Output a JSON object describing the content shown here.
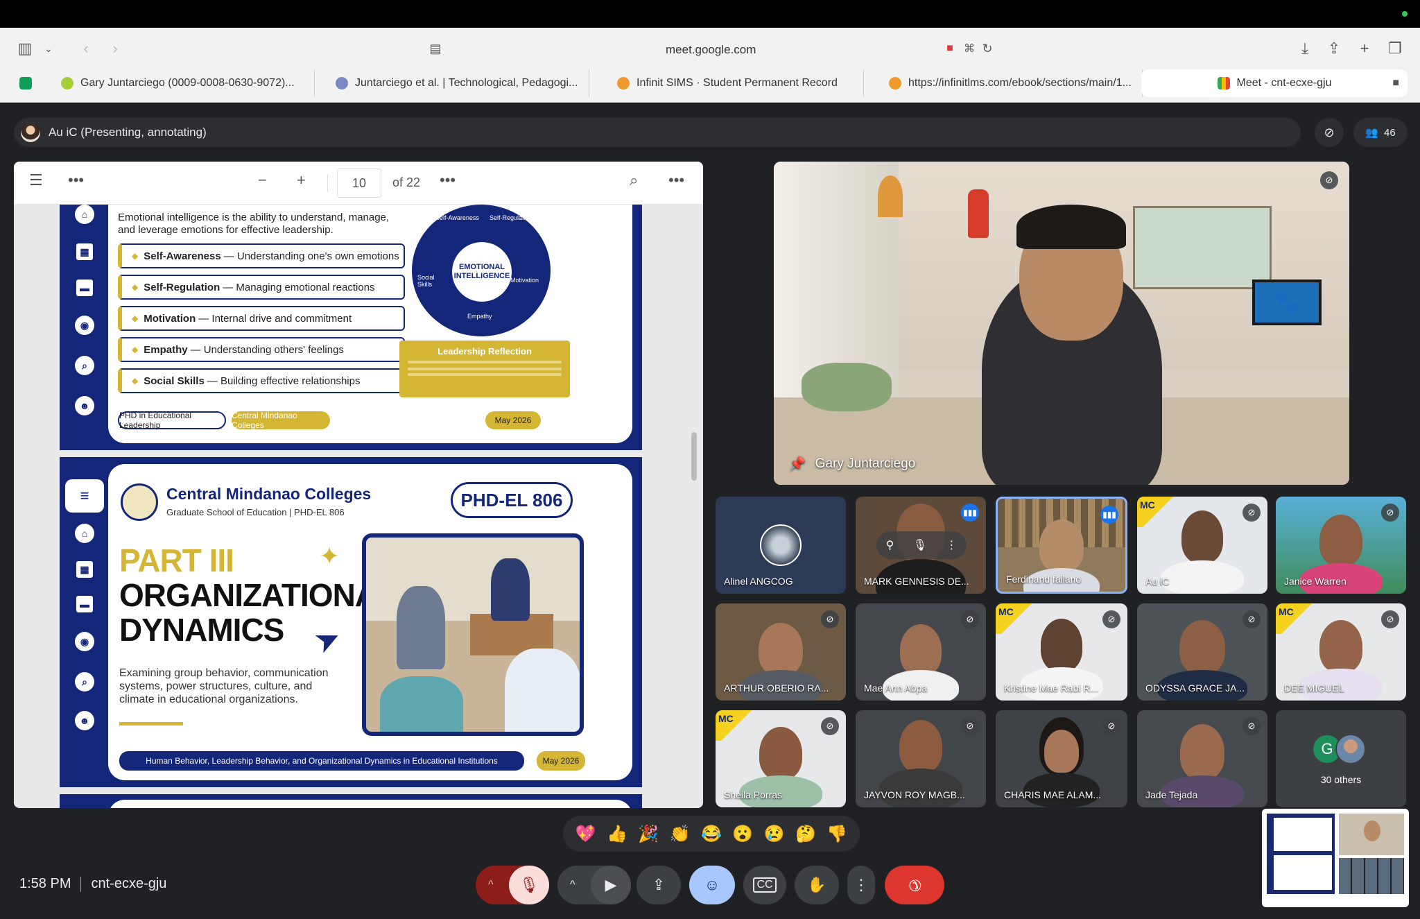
{
  "browser": {
    "url": "meet.google.com",
    "tabs": [
      {
        "label": "Gary Juntarciego (0009-0008-0630-9072)..."
      },
      {
        "label": "Juntarciego et al. | Technological, Pedagogi..."
      },
      {
        "label": "Infinit SIMS · Student Permanent Record"
      },
      {
        "label": "https://infinitlms.com/ebook/sections/main/1..."
      },
      {
        "label": "Meet - cnt-ecxe-gju"
      }
    ]
  },
  "meet": {
    "presenter_label": "Au iC (Presenting, annotating)",
    "participant_count": "46",
    "time": "1:58 PM",
    "meeting_code": "cnt-ecxe-gju",
    "reactions": [
      "💖",
      "👍",
      "🎉",
      "👏",
      "😂",
      "😮",
      "😢",
      "🤔",
      "👎"
    ]
  },
  "pdf": {
    "page_current": "10",
    "page_total": "of 22",
    "slide1": {
      "intro": "Emotional intelligence is the ability to understand, manage, and leverage emotions for effective leadership.",
      "items": [
        {
          "term": "Self-Awareness",
          "desc": "— Understanding one's own emotions"
        },
        {
          "term": "Self-Regulation",
          "desc": "— Managing emotional reactions"
        },
        {
          "term": "Motivation",
          "desc": "— Internal drive and commitment"
        },
        {
          "term": "Empathy",
          "desc": "— Understanding others' feelings"
        },
        {
          "term": "Social Skills",
          "desc": "— Building effective relationships"
        }
      ],
      "wheel_center": "EMOTIONAL INTELLIGENCE",
      "wheel_labels": [
        "Self-Awareness",
        "Self-Regulation",
        "Motivation",
        "Empathy",
        "Social Skills"
      ],
      "reflection_title": "Leadership Reflection",
      "footer_left": "PHD in Educational Leadership",
      "footer_mid": "Central Mindanao Colleges",
      "footer_right": "May 2026"
    },
    "slide2": {
      "school": "Central Mindanao Colleges",
      "school_sub": "Graduate School of Education | PHD-EL 806",
      "course_badge": "PHD-EL 806",
      "part": "PART III",
      "title_line1": "ORGANIZATIONAL",
      "title_line2": "DYNAMICS",
      "description": "Examining group behavior, communication systems, power structures, culture, and climate in educational organizations.",
      "footer_bar": "Human Behavior, Leadership Behavior, and Organizational Dynamics in Educational Institutions",
      "footer_date": "May 2026"
    }
  },
  "main_speaker": {
    "name": "Gary Juntarciego"
  },
  "tiles": [
    {
      "name": "Alinel ANGCOG"
    },
    {
      "name": "MARK GENNESIS DE..."
    },
    {
      "name": "Ferdinand failano"
    },
    {
      "name": "Au iC"
    },
    {
      "name": "Janice Warren"
    },
    {
      "name": "ARTHUR OBERIO RA..."
    },
    {
      "name": "Mae Ann Abpa"
    },
    {
      "name": "Kristine Mae Rabi R..."
    },
    {
      "name": "ODYSSA GRACE JA..."
    },
    {
      "name": "DEE MIGUEL"
    },
    {
      "name": "Sheila Porras"
    },
    {
      "name": "JAYVON ROY MAGB..."
    },
    {
      "name": "CHARIS MAE ALAM..."
    },
    {
      "name": "Jade Tejada"
    }
  ],
  "others": {
    "initial": "G",
    "label": "30 others"
  },
  "colors": {
    "end_call": "#ea4335",
    "mic_off": "#f9dedc",
    "emoji_active": "#a8c7fa",
    "accent_navy": "#13267a",
    "accent_gold": "#d4b634"
  }
}
